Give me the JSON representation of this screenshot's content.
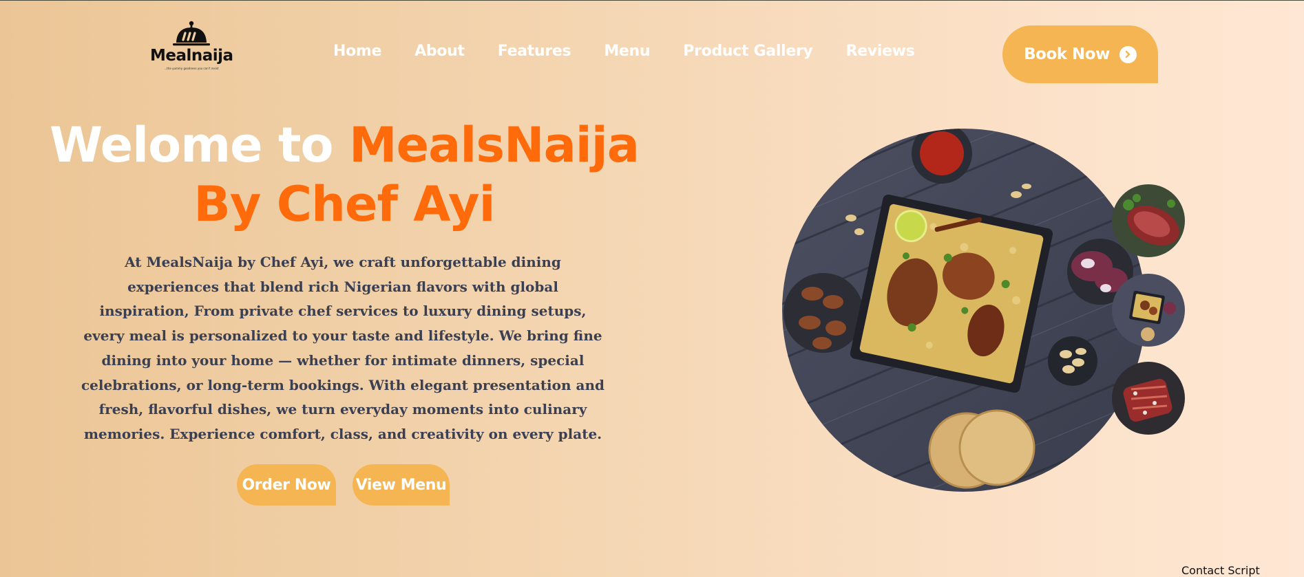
{
  "logo": {
    "name": "Mealnaija",
    "tagline": "...the yummy goodness you can't resist"
  },
  "nav": {
    "items": [
      "Home",
      "About",
      "Features",
      "Menu",
      "Product Gallery",
      "Reviews"
    ]
  },
  "header": {
    "book_label": "Book Now"
  },
  "hero": {
    "title_white": "Welome to ",
    "title_orange": "MealsNaija By Chef Ayi",
    "description": "At MealsNaija by Chef Ayi, we craft unforgettable dining experiences that blend rich Nigerian flavors with global inspiration, From private chef services to luxury dining setups, every meal is personalized to your taste and lifestyle. We bring fine dining into your home — whether for intimate dinners, special celebrations, or long-term bookings. With elegant presentation and fresh, flavorful dishes, we turn everyday moments into culinary memories. Experience comfort, class, and creativity on every plate.",
    "order_label": "Order Now",
    "menu_label": "View Menu"
  },
  "footer_peek": {
    "text": "Contact Script"
  },
  "colors": {
    "accent": "#f5b552",
    "title_orange": "#ff6a0a",
    "body_text": "#3a3f52"
  }
}
